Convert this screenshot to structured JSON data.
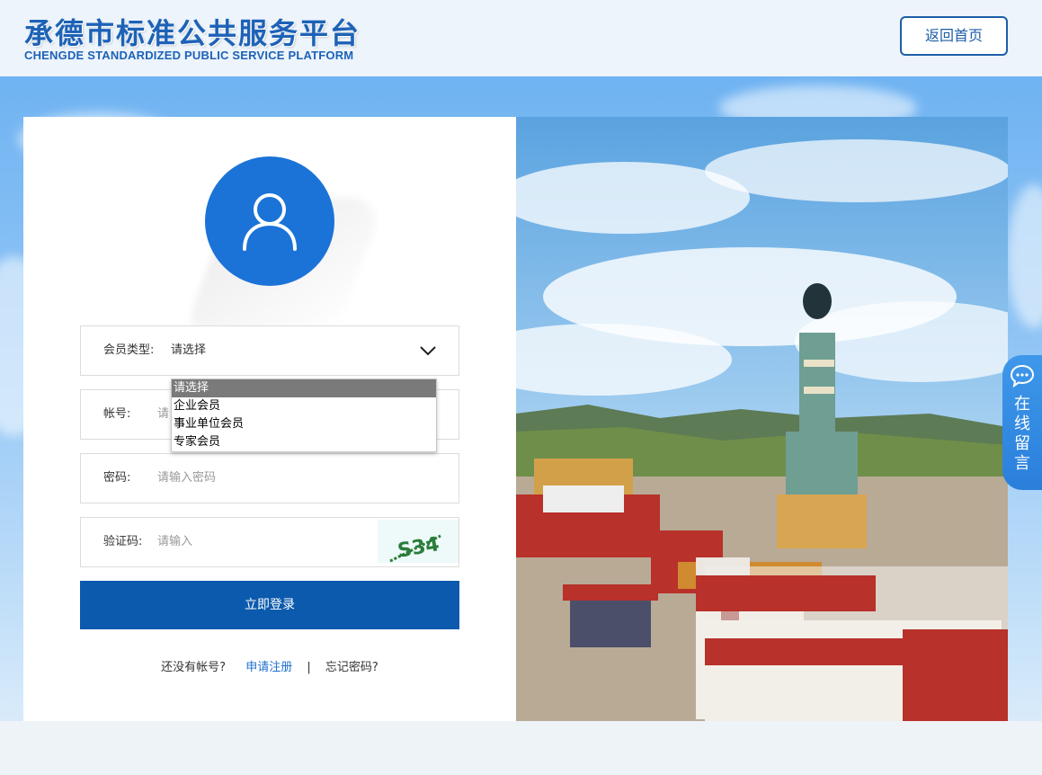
{
  "header": {
    "title_cn": "承德市标准公共服务平台",
    "title_en": "CHENGDE STANDARDIZED PUBLIC SERVICE PLATFORM",
    "home_button": "返回首页"
  },
  "form": {
    "member_type": {
      "label": "会员类型:",
      "selected": "请选择"
    },
    "dropdown_options": [
      "请选择",
      "企业会员",
      "事业单位会员",
      "专家会员"
    ],
    "account": {
      "label": "帐号:",
      "placeholder": "请"
    },
    "password": {
      "label": "密码:",
      "placeholder": "请输入密码"
    },
    "captcha": {
      "label": "验证码:",
      "placeholder": "请输入",
      "image_text": "S34"
    },
    "login_button": "立即登录"
  },
  "links": {
    "no_account": "还没有帐号?",
    "register": "申请注册",
    "separator": "|",
    "forgot": "忘记密码?"
  },
  "chat_tab": {
    "label": "在线留言",
    "icon": "chat-bubble-icon"
  },
  "colors": {
    "brand": "#1d62b7",
    "primary_button": "#0c5aad",
    "avatar": "#1b73d8",
    "link": "#1d6fcf"
  }
}
